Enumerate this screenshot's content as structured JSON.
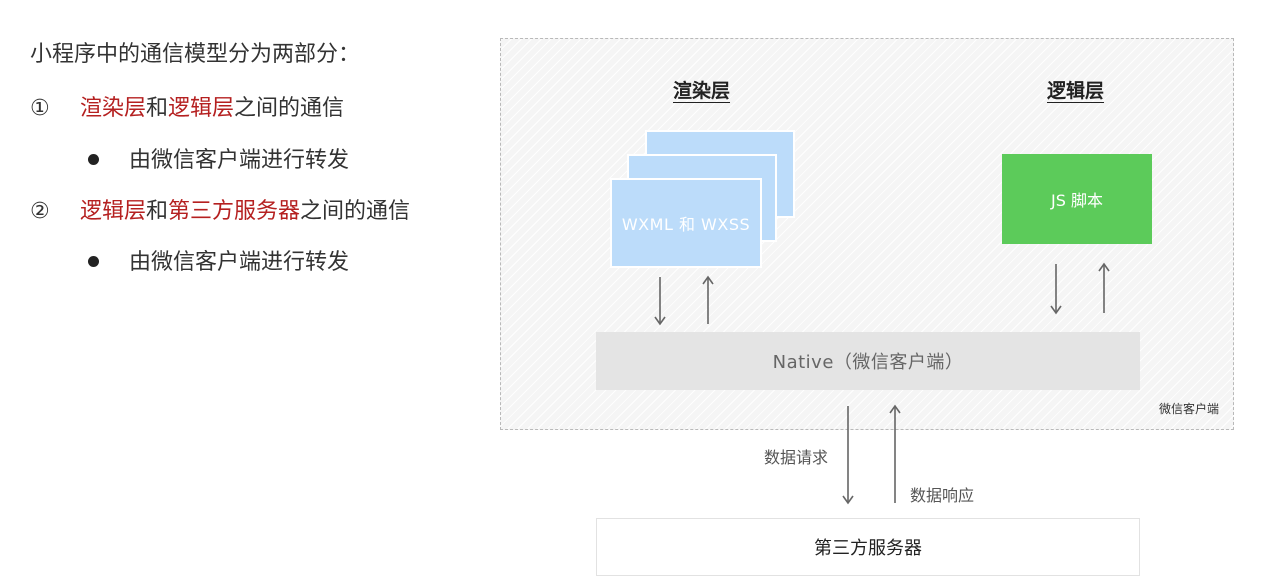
{
  "intro": "小程序中的通信模型分为两部分：",
  "items": [
    {
      "num": "①",
      "part1": "渲染层",
      "join": "和",
      "part2": "逻辑层",
      "suffix": "之间的通信",
      "sub": "由微信客户端进行转发"
    },
    {
      "num": "②",
      "part1": "逻辑层",
      "join": "和",
      "part2": "第三方服务器",
      "suffix": "之间的通信",
      "sub": "由微信客户端进行转发"
    }
  ],
  "diagram": {
    "render_layer_title": "渲染层",
    "logic_layer_title": "逻辑层",
    "wxml_label": "WXML 和 WXSS",
    "js_label": "JS 脚本",
    "native_label": "Native（微信客户端）",
    "client_label": "微信客户端",
    "request_label": "数据请求",
    "response_label": "数据响应",
    "server_label": "第三方服务器"
  },
  "colors": {
    "highlight": "#b52020",
    "render_card": "#bcdcfa",
    "js_box": "#5ccb5a",
    "native_bar": "#e4e4e4"
  }
}
